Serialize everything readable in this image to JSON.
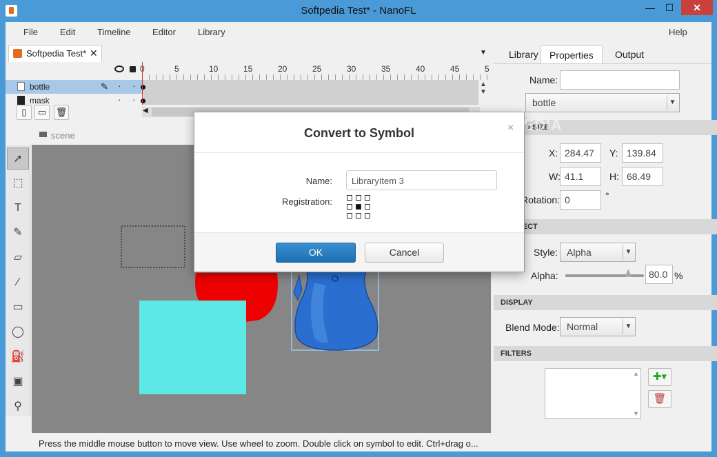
{
  "window": {
    "title": "Softpedia Test* - NanoFL",
    "min_glyph": "—",
    "max_glyph": "☐",
    "close_glyph": "✕"
  },
  "menu": [
    "File",
    "Edit",
    "Timeline",
    "Editor",
    "Library",
    "Help"
  ],
  "document_tab": {
    "label": "Softpedia Test*",
    "close_glyph": "✕"
  },
  "timeline": {
    "ruler": [
      "0",
      "5",
      "10",
      "15",
      "20",
      "25",
      "30",
      "35",
      "40",
      "45",
      "5"
    ],
    "layers": [
      {
        "name": "bottle",
        "selected": true
      },
      {
        "name": "mask",
        "selected": false
      }
    ]
  },
  "scene": {
    "label": "scene"
  },
  "status": "Press the middle mouse button to move view. Use wheel to zoom. Double click on symbol to edit. Ctrl+drag o...",
  "right_panel": {
    "tabs": [
      "Library",
      "Properties",
      "Output"
    ],
    "name_label": "Name:",
    "name_value": "",
    "symbol_select": "bottle",
    "section_position": "ON AND SIZE",
    "x_label": "X:",
    "x_value": "284.47",
    "y_label": "Y:",
    "y_value": "139.84",
    "w_label": "W:",
    "w_value": "41.1",
    "h_label": "H:",
    "h_value": "68.49",
    "rotation_label": "Rotation:",
    "rotation_value": "0",
    "rotation_unit": "°",
    "section_effect": "R EFFECT",
    "style_label": "Style:",
    "style_value": "Alpha",
    "alpha_label": "Alpha:",
    "alpha_value": "80.0",
    "alpha_unit": "%",
    "alpha_level": 0.8,
    "section_display": "DISPLAY",
    "blend_label": "Blend Mode:",
    "blend_value": "Normal",
    "section_filters": "FILTERS"
  },
  "dialog": {
    "title": "Convert to Symbol",
    "close_glyph": "×",
    "name_label": "Name:",
    "name_value": "LibraryItem 3",
    "registration_label": "Registration:",
    "ok_label": "OK",
    "cancel_label": "Cancel"
  },
  "watermark": "SOFTPEDIA",
  "colors": {
    "accent": "#4a9ad8",
    "canvas_bg": "#868686",
    "red_shape": "#ee0000",
    "cyan_shape": "#5ce8e4",
    "bottle_blue": "#2a6fd0",
    "ok_button": "#2a7fc4"
  }
}
